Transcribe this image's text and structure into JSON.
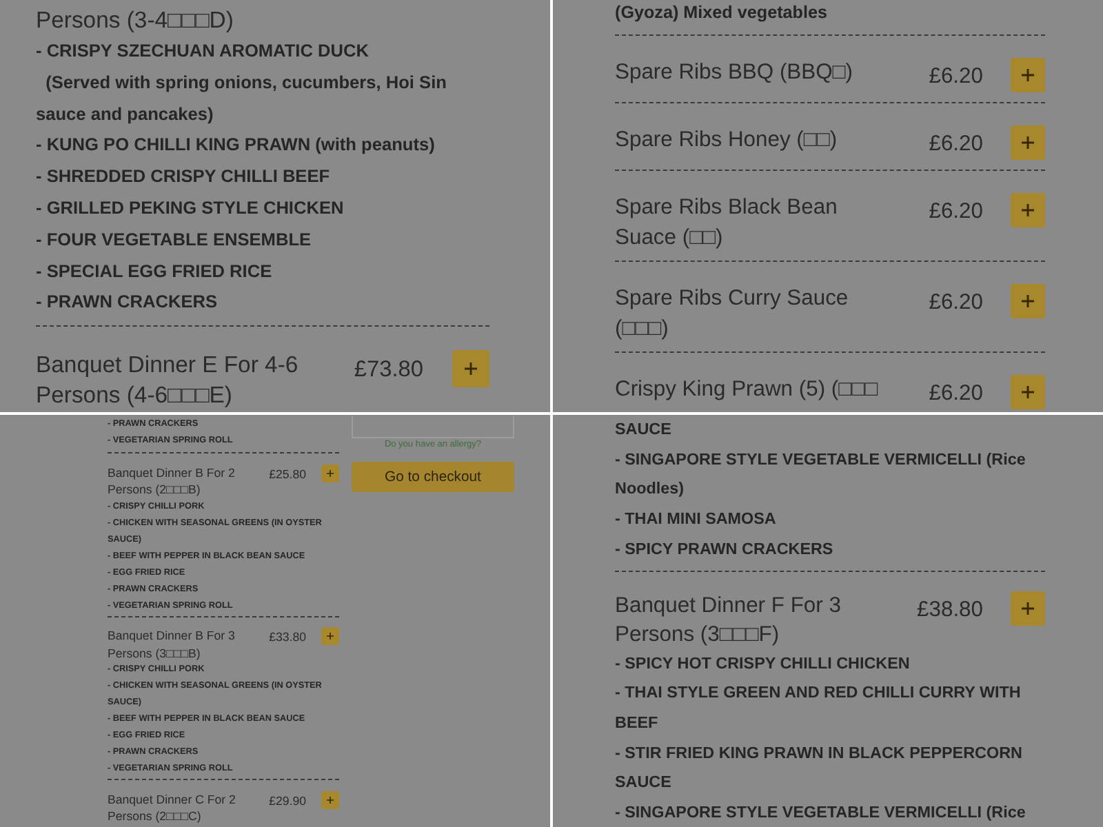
{
  "panels": [
    {
      "kind": "menu",
      "entries": [
        {
          "name": "Persons (3-4□□□D)",
          "lines": [
            "- CRISPY SZECHUAN AROMATIC DUCK",
            "  (Served with spring onions, cucumbers, Hoi Sin sauce and pancakes)",
            "- KUNG PO CHILLI KING PRAWN (with peanuts)",
            "- SHREDDED CRISPY CHILLI BEEF",
            "- GRILLED PEKING STYLE CHICKEN",
            "- FOUR VEGETABLE ENSEMBLE",
            "- SPECIAL EGG FRIED RICE",
            "- PRAWN CRACKERS"
          ]
        },
        {
          "name": "Banquet Dinner E For 4-6 Persons (4-6□□□E)",
          "price": "£73.80"
        }
      ]
    },
    {
      "kind": "menu",
      "entries": [
        {
          "lines": [
            "(Gyoza) Mixed vegetables"
          ]
        },
        {
          "name": "Spare Ribs BBQ (BBQ□)",
          "price": "£6.20"
        },
        {
          "name": "Spare Ribs Honey (□□)",
          "price": "£6.20"
        },
        {
          "name": "Spare Ribs Black Bean Suace (□□)",
          "price": "£6.20"
        },
        {
          "name": "Spare Ribs Curry Sauce (□□□)",
          "price": "£6.20"
        },
        {
          "name": "Crispy King Prawn (5) (□□□",
          "price": "£6.20"
        }
      ]
    },
    {
      "kind": "checkout",
      "entries": [
        {
          "lines": [
            "- PRAWN CRACKERS",
            "- VEGETARIAN SPRING ROLL"
          ]
        },
        {
          "name": "Banquet Dinner B For 2 Persons (2□□□B)",
          "price": "£25.80",
          "lines": [
            "- CRISPY CHILLI PORK",
            "- CHICKEN WITH SEASONAL GREENS (IN OYSTER SAUCE)",
            "- BEEF WITH PEPPER IN BLACK BEAN SAUCE",
            "- EGG FRIED RICE",
            "- PRAWN CRACKERS",
            "- VEGETARIAN SPRING ROLL"
          ]
        },
        {
          "name": "Banquet Dinner B For 3 Persons (3□□□B)",
          "price": "£33.80",
          "lines": [
            "- CRISPY CHILLI PORK",
            "- CHICKEN WITH SEASONAL GREENS (IN OYSTER SAUCE)",
            "- BEEF WITH PEPPER IN BLACK BEAN SAUCE",
            "- EGG FRIED RICE",
            "- PRAWN CRACKERS",
            "- VEGETARIAN SPRING ROLL"
          ]
        },
        {
          "name": "Banquet Dinner C For 2 Persons (2□□□C)",
          "price": "£29.90"
        }
      ],
      "cart": {
        "allergy_link": "Do you have an allergy?",
        "checkout_button": "Go to checkout"
      }
    },
    {
      "kind": "menu",
      "entries": [
        {
          "lines": [
            "SAUCE",
            "- SINGAPORE STYLE VEGETABLE VERMICELLI (Rice Noodles)",
            "- THAI MINI SAMOSA",
            "- SPICY PRAWN CRACKERS"
          ]
        },
        {
          "name": "Banquet Dinner F For 3 Persons (3□□□F)",
          "price": "£38.80",
          "lines": [
            "- SPICY HOT CRISPY CHILLI CHICKEN",
            "- THAI STYLE GREEN AND RED CHILLI CURRY WITH BEEF",
            "- STIR FRIED KING PRAWN IN BLACK PEPPERCORN SAUCE",
            "- SINGAPORE STYLE VEGETABLE VERMICELLI (Rice"
          ]
        }
      ]
    }
  ]
}
